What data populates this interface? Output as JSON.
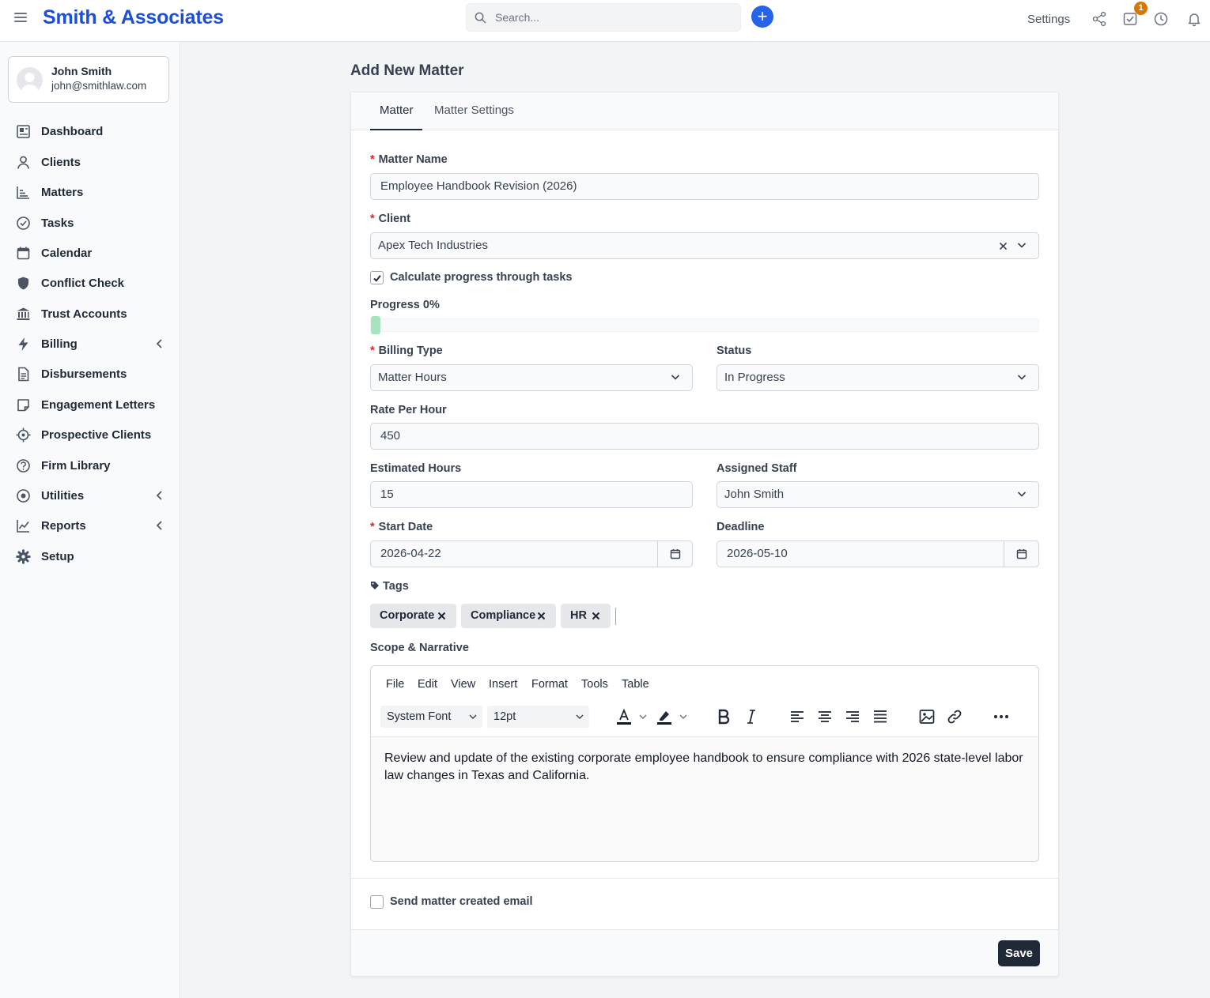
{
  "header": {
    "brand": "Smith & Associates",
    "search_placeholder": "Search...",
    "settings_label": "Settings",
    "tasks_badge": "1"
  },
  "user": {
    "name": "John Smith",
    "email": "john@smithlaw.com"
  },
  "sidebar": {
    "items": [
      {
        "label": "Dashboard",
        "icon": "dashboard-icon"
      },
      {
        "label": "Clients",
        "icon": "user-icon"
      },
      {
        "label": "Matters",
        "icon": "chart-icon"
      },
      {
        "label": "Tasks",
        "icon": "check-circle-icon"
      },
      {
        "label": "Calendar",
        "icon": "calendar-icon"
      },
      {
        "label": "Conflict Check",
        "icon": "shield-icon"
      },
      {
        "label": "Trust Accounts",
        "icon": "bank-icon"
      },
      {
        "label": "Billing",
        "icon": "bolt-icon"
      },
      {
        "label": "Disbursements",
        "icon": "document-icon"
      },
      {
        "label": "Engagement Letters",
        "icon": "note-icon"
      },
      {
        "label": "Prospective Clients",
        "icon": "crosshair-icon"
      },
      {
        "label": "Firm Library",
        "icon": "help-circle-icon"
      },
      {
        "label": "Utilities",
        "icon": "target-icon"
      },
      {
        "label": "Reports",
        "icon": "line-chart-icon"
      },
      {
        "label": "Setup",
        "icon": "gear-icon"
      }
    ]
  },
  "page": {
    "title": "Add New Matter"
  },
  "tabs": [
    {
      "label": "Matter"
    },
    {
      "label": "Matter Settings"
    }
  ],
  "form": {
    "matter_name": {
      "label": "Matter Name",
      "value": "Employee Handbook Revision (2026)"
    },
    "client": {
      "label": "Client",
      "value": "Apex Tech Industries"
    },
    "calc_progress": {
      "label": "Calculate progress through tasks",
      "checked": true
    },
    "progress": {
      "label": "Progress 0%",
      "value": 0
    },
    "billing_type": {
      "label": "Billing Type",
      "value": "Matter Hours"
    },
    "status": {
      "label": "Status",
      "value": "In Progress"
    },
    "rate_per_hour": {
      "label": "Rate Per Hour",
      "value": "450"
    },
    "estimated_hours": {
      "label": "Estimated Hours",
      "value": "15"
    },
    "assigned_staff": {
      "label": "Assigned Staff",
      "value": "John Smith"
    },
    "start_date": {
      "label": "Start Date",
      "value": "2026-04-22"
    },
    "deadline": {
      "label": "Deadline",
      "value": "2026-05-10"
    },
    "tags": {
      "label": "Tags",
      "items": [
        "Corporate",
        "Compliance",
        "HR"
      ]
    },
    "scope": {
      "label": "Scope & Narrative",
      "menu": [
        "File",
        "Edit",
        "View",
        "Insert",
        "Format",
        "Tools",
        "Table"
      ],
      "font": "System Font",
      "size": "12pt",
      "content": "Review and update of the existing corporate employee handbook to ensure compliance with 2026 state-level labor law changes in Texas and California."
    },
    "send_email": {
      "label": "Send matter created email",
      "checked": false
    },
    "save_label": "Save"
  },
  "colors": {
    "brand": "#1d4ed8",
    "accent": "#2563eb",
    "badge": "#d97706",
    "progress": "#a7e3bf",
    "required": "#dc2626"
  }
}
